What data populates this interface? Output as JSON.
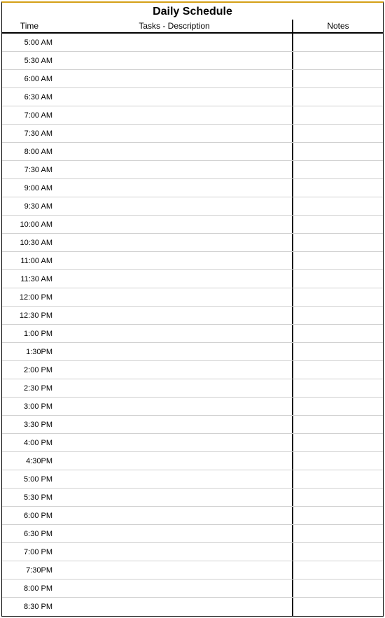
{
  "title": "Daily Schedule",
  "headers": {
    "time": "Time",
    "tasks": "Tasks - Description",
    "notes": "Notes"
  },
  "rows": [
    {
      "time": "5:00 AM",
      "tasks": "",
      "notes": ""
    },
    {
      "time": "5:30 AM",
      "tasks": "",
      "notes": ""
    },
    {
      "time": "6:00 AM",
      "tasks": "",
      "notes": ""
    },
    {
      "time": "6:30 AM",
      "tasks": "",
      "notes": ""
    },
    {
      "time": "7:00 AM",
      "tasks": "",
      "notes": ""
    },
    {
      "time": "7:30 AM",
      "tasks": "",
      "notes": ""
    },
    {
      "time": "8:00 AM",
      "tasks": "",
      "notes": ""
    },
    {
      "time": "7:30 AM",
      "tasks": "",
      "notes": ""
    },
    {
      "time": "9:00 AM",
      "tasks": "",
      "notes": ""
    },
    {
      "time": "9:30 AM",
      "tasks": "",
      "notes": ""
    },
    {
      "time": "10:00 AM",
      "tasks": "",
      "notes": ""
    },
    {
      "time": "10:30 AM",
      "tasks": "",
      "notes": ""
    },
    {
      "time": "11:00 AM",
      "tasks": "",
      "notes": ""
    },
    {
      "time": "11:30 AM",
      "tasks": "",
      "notes": ""
    },
    {
      "time": "12:00 PM",
      "tasks": "",
      "notes": ""
    },
    {
      "time": "12:30 PM",
      "tasks": "",
      "notes": ""
    },
    {
      "time": "1:00 PM",
      "tasks": "",
      "notes": ""
    },
    {
      "time": "1:30PM",
      "tasks": "",
      "notes": ""
    },
    {
      "time": "2:00 PM",
      "tasks": "",
      "notes": ""
    },
    {
      "time": "2:30 PM",
      "tasks": "",
      "notes": ""
    },
    {
      "time": "3:00 PM",
      "tasks": "",
      "notes": ""
    },
    {
      "time": "3:30 PM",
      "tasks": "",
      "notes": ""
    },
    {
      "time": "4:00 PM",
      "tasks": "",
      "notes": ""
    },
    {
      "time": "4:30PM",
      "tasks": "",
      "notes": ""
    },
    {
      "time": "5:00 PM",
      "tasks": "",
      "notes": ""
    },
    {
      "time": "5:30 PM",
      "tasks": "",
      "notes": ""
    },
    {
      "time": "6:00 PM",
      "tasks": "",
      "notes": ""
    },
    {
      "time": "6:30 PM",
      "tasks": "",
      "notes": ""
    },
    {
      "time": "7:00 PM",
      "tasks": "",
      "notes": ""
    },
    {
      "time": "7:30PM",
      "tasks": "",
      "notes": ""
    },
    {
      "time": "8:00 PM",
      "tasks": "",
      "notes": ""
    },
    {
      "time": "8:30 PM",
      "tasks": "",
      "notes": ""
    }
  ]
}
